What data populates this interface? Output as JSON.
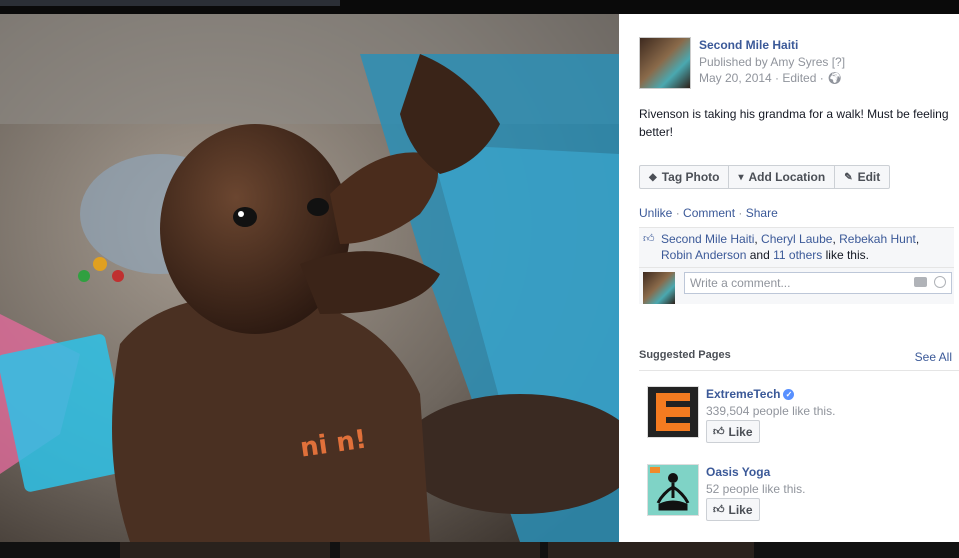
{
  "post": {
    "page_name": "Second Mile Haiti",
    "published_by": "Published by Amy Syres [?]",
    "date_line": "May 20, 2014 · Edited ·",
    "caption": "Rivenson is taking his grandma for a walk! Must be feeling better!"
  },
  "photo_actions": {
    "tag_label": "Tag Photo",
    "location_label": "Add Location",
    "edit_label": "Edit"
  },
  "feedback": {
    "unlike": "Unlike",
    "comment": "Comment",
    "share": "Share",
    "liked_names": [
      "Second Mile Haiti",
      "Cheryl Laube",
      "Rebekah Hunt",
      "Robin Anderson"
    ],
    "and_text": "and",
    "others": "11 others",
    "tail": "like this.",
    "comment_placeholder": "Write a comment..."
  },
  "shirt_text": "ni n!",
  "suggested": {
    "title": "Suggested Pages",
    "see_all": "See All",
    "items": [
      {
        "name": "ExtremeTech",
        "likes": "339,504 people like this.",
        "like_label": "Like",
        "verified": true
      },
      {
        "name": "Oasis Yoga",
        "likes": "52 people like this.",
        "like_label": "Like",
        "verified": false
      }
    ]
  },
  "colors": {
    "link": "#3b5998",
    "muted": "#90949c",
    "extremetech_orange": "#f47b20",
    "yoga_teal": "#7fd3c6"
  }
}
